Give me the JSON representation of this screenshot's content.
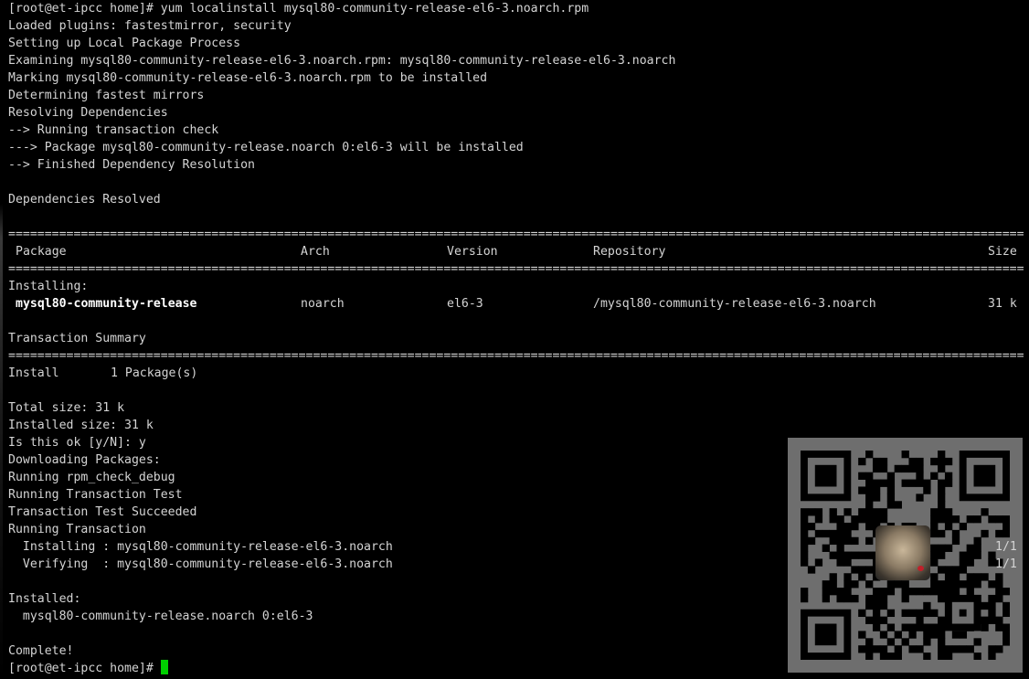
{
  "terminal": {
    "lines": [
      "[root@et-ipcc home]# yum localinstall mysql80-community-release-el6-3.noarch.rpm",
      "Loaded plugins: fastestmirror, security",
      "Setting up Local Package Process",
      "Examining mysql80-community-release-el6-3.noarch.rpm: mysql80-community-release-el6-3.noarch",
      "Marking mysql80-community-release-el6-3.noarch.rpm to be installed",
      "Determining fastest mirrors",
      "Resolving Dependencies",
      "--> Running transaction check",
      "---> Package mysql80-community-release.noarch 0:el6-3 will be installed",
      "--> Finished Dependency Resolution",
      "Dependencies Resolved"
    ],
    "rule_char": "=",
    "table": {
      "headers": {
        "package": "Package",
        "arch": "Arch",
        "version": "Version",
        "repository": "Repository",
        "size": "Size"
      },
      "section_label": "Installing:",
      "rows": [
        {
          "package": "mysql80-community-release",
          "arch": "noarch",
          "version": "el6-3",
          "repository": "/mysql80-community-release-el6-3.noarch",
          "size": "31 k"
        }
      ]
    },
    "summary": {
      "title": "Transaction Summary",
      "install_label": "Install",
      "install_value": "1 Package(s)"
    },
    "post_lines": [
      "Total size: 31 k",
      "Installed size: 31 k",
      "Is this ok [y/N]: y",
      "Downloading Packages:",
      "Running rpm_check_debug",
      "Running Transaction Test",
      "Transaction Test Succeeded",
      "Running Transaction"
    ],
    "progress": [
      {
        "action": "  Installing : mysql80-community-release-el6-3.noarch",
        "count": "1/1"
      },
      {
        "action": "  Verifying  : mysql80-community-release-el6-3.noarch",
        "count": "1/1"
      }
    ],
    "installed_label": "Installed:",
    "installed_item": "  mysql80-community-release.noarch 0:el6-3",
    "complete": "Complete!",
    "prompt": "[root@et-ipcc home]# "
  },
  "colors": {
    "background": "#000000",
    "foreground": "#d4d4d4",
    "cursor": "#00d000",
    "qr_panel": "#6e6e6e"
  },
  "icons": {
    "qr": "qr-code-icon",
    "avatar": "pug-avatar-icon"
  }
}
